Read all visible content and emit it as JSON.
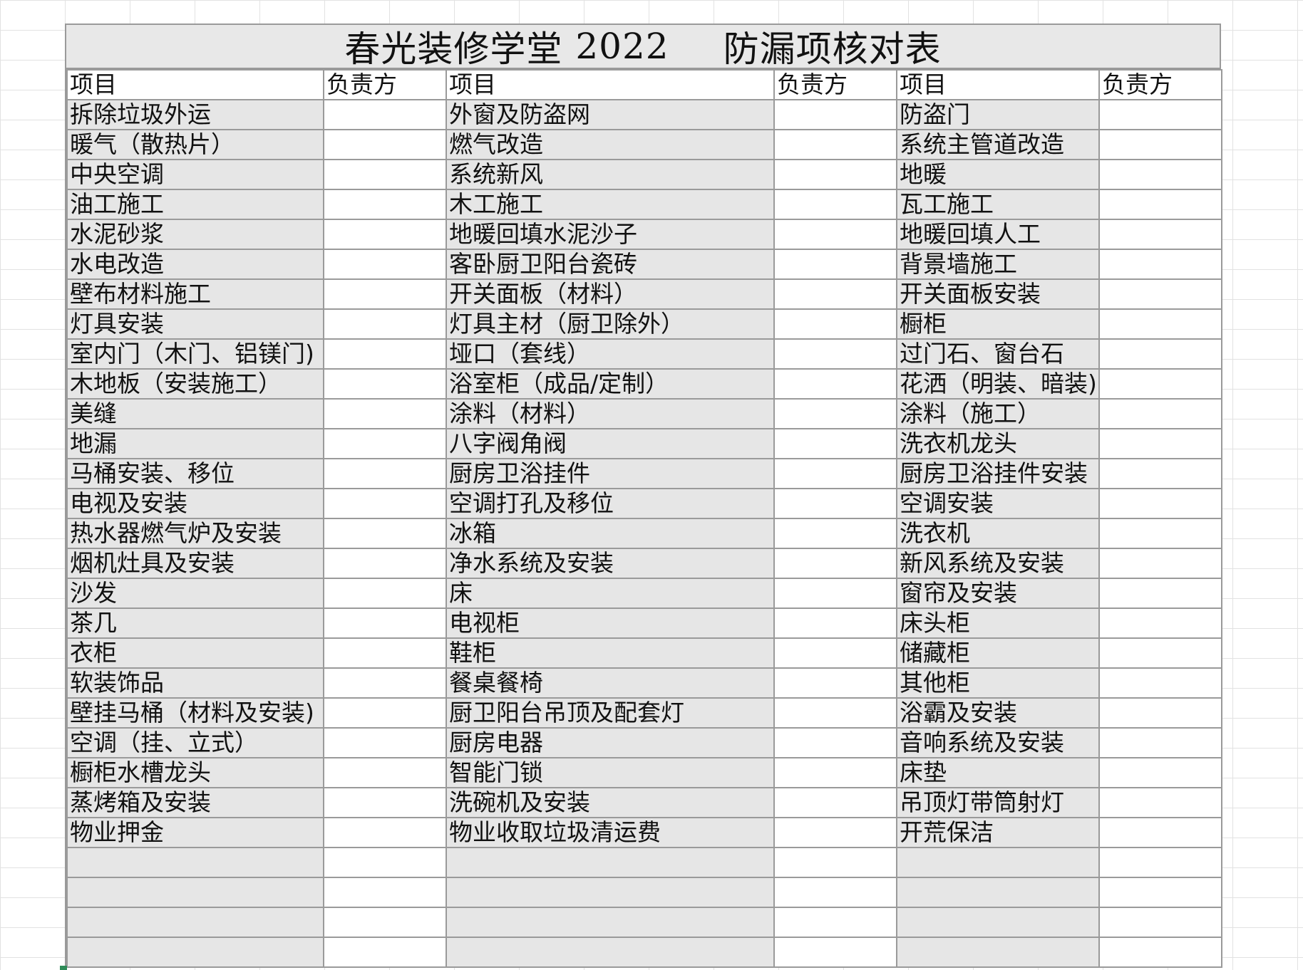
{
  "title": {
    "text": "春光装修学堂",
    "year": "2022",
    "subtitle": "防漏项核对表"
  },
  "headers": [
    "项目",
    "负责方",
    "项目",
    "负责方",
    "项目",
    "负责方"
  ],
  "rows": [
    [
      "拆除垃圾外运",
      "外窗及防盗网",
      "防盗门"
    ],
    [
      "暖气（散热片）",
      "燃气改造",
      "系统主管道改造"
    ],
    [
      "中央空调",
      "系统新风",
      "地暖"
    ],
    [
      "油工施工",
      "木工施工",
      "瓦工施工"
    ],
    [
      "水泥砂浆",
      "地暖回填水泥沙子",
      "地暖回填人工"
    ],
    [
      "水电改造",
      "客卧厨卫阳台瓷砖",
      "背景墙施工"
    ],
    [
      "壁布材料施工",
      "开关面板（材料）",
      "开关面板安装"
    ],
    [
      "灯具安装",
      "灯具主材（厨卫除外）",
      "橱柜"
    ],
    [
      "室内门（木门、铝镁门)",
      "垭口（套线）",
      "过门石、窗台石"
    ],
    [
      "木地板（安装施工）",
      "浴室柜（成品/定制）",
      "花洒（明装、暗装)"
    ],
    [
      "美缝",
      "涂料（材料）",
      "涂料（施工）"
    ],
    [
      "地漏",
      "八字阀角阀",
      "洗衣机龙头"
    ],
    [
      "马桶安装、移位",
      "厨房卫浴挂件",
      "厨房卫浴挂件安装"
    ],
    [
      "电视及安装",
      "空调打孔及移位",
      "空调安装"
    ],
    [
      "热水器燃气炉及安装",
      "冰箱",
      "洗衣机"
    ],
    [
      "烟机灶具及安装",
      "净水系统及安装",
      "新风系统及安装"
    ],
    [
      "沙发",
      "床",
      "窗帘及安装"
    ],
    [
      "茶几",
      "电视柜",
      "床头柜"
    ],
    [
      "衣柜",
      "鞋柜",
      "储藏柜"
    ],
    [
      "软装饰品",
      "餐桌餐椅",
      "其他柜"
    ],
    [
      "壁挂马桶（材料及安装)",
      "厨卫阳台吊顶及配套灯",
      "浴霸及安装"
    ],
    [
      "空调（挂、立式）",
      "厨房电器",
      "音响系统及安装"
    ],
    [
      "橱柜水槽龙头",
      "智能门锁",
      "床垫"
    ],
    [
      "蒸烤箱及安装",
      "洗碗机及安装",
      "吊顶灯带筒射灯"
    ],
    [
      "物业押金",
      "物业收取垃圾清运费",
      "开荒保洁"
    ],
    [
      "",
      "",
      ""
    ],
    [
      "",
      "",
      ""
    ],
    [
      "",
      "",
      ""
    ],
    [
      "",
      "",
      ""
    ]
  ]
}
